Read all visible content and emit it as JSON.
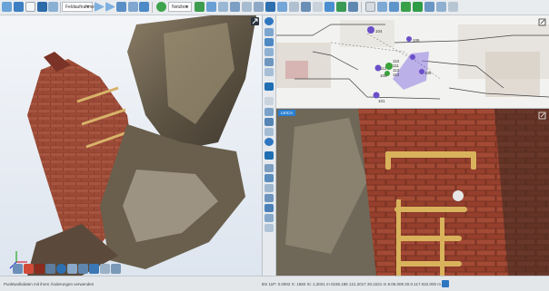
{
  "toolbar": {
    "layer_select": "Feldaufnahme",
    "view_select": "Netzbox",
    "active_view_label": ""
  },
  "map": {
    "labels": [
      "104",
      "106",
      "110",
      "111",
      "112",
      "113",
      "113",
      "105",
      "108",
      "101"
    ]
  },
  "bottom_view": {
    "tab_label": "LEICA"
  },
  "status": {
    "left_text": "Punktwolkdaten mit ihren Änderungen verwenden",
    "coordinates": "8m 11P: 0.0002 X: 1582 Xi: 1,3021 m    0235.186 121.2017 20.2221 m    8.05.009 20.0.117.022.000 m"
  },
  "colors": {
    "toolbar_bg": "#e9ecef",
    "accent_blue": "#1f6fb2",
    "map_marker_purple": "#6a4fc8",
    "map_marker_green": "#3aa33a"
  },
  "icons": {
    "maximize_icon": "corner-expand-icon"
  }
}
